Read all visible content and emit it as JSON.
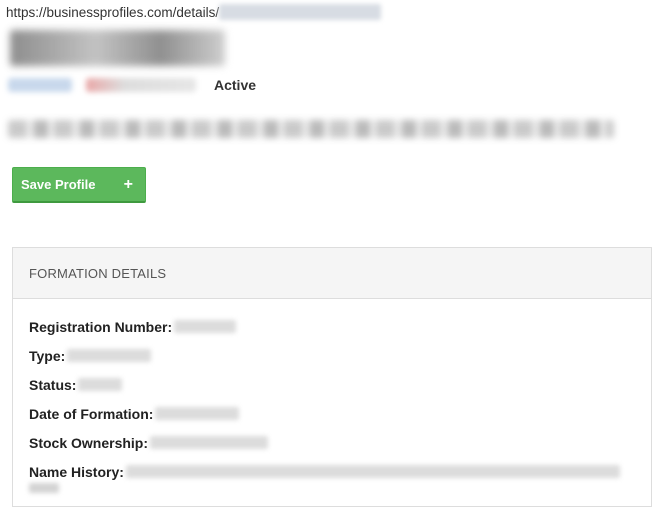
{
  "address_bar": {
    "url_prefix": "https://businessprofiles.com/details/"
  },
  "profile": {
    "status": "Active"
  },
  "actions": {
    "save_label": "Save Profile",
    "save_icon": "+"
  },
  "formation_details": {
    "heading": "FORMATION DETAILS",
    "fields": [
      {
        "label": "Registration Number:"
      },
      {
        "label": "Type:"
      },
      {
        "label": "Status:"
      },
      {
        "label": "Date of Formation:"
      },
      {
        "label": "Stock Ownership:"
      },
      {
        "label": "Name History:"
      }
    ]
  },
  "colors": {
    "primary_button": "#5cb85c",
    "panel_header_bg": "#f5f5f5",
    "panel_border": "#dddddd"
  }
}
